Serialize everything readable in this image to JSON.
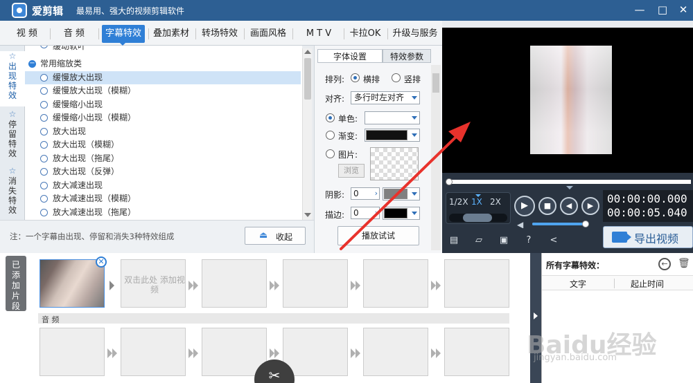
{
  "window": {
    "app_name": "爱剪辑",
    "tagline": "最易用、强大的视频剪辑软件",
    "minimize": "—",
    "maximize": "□",
    "close": "✕"
  },
  "menu_tabs": [
    "视 频",
    "音 频",
    "字幕特效",
    "叠加素材",
    "转场特效",
    "画面风格",
    "M T V",
    "卡拉OK",
    "升级与服务"
  ],
  "active_menu_tab": "字幕特效",
  "side_tabs": [
    {
      "label": "出现特效",
      "icon": "star-icon",
      "active": true
    },
    {
      "label": "停留特效",
      "icon": "star-icon",
      "active": false
    },
    {
      "label": "消失特效",
      "icon": "star-icon",
      "active": false
    }
  ],
  "effects_list": {
    "partial_top": "缓动软叶",
    "category": "常用缩放类",
    "items": [
      "缓慢放大出现",
      "缓慢放大出现（模糊）",
      "缓慢缩小出现",
      "缓慢缩小出现（模糊）",
      "放大出现",
      "放大出现（模糊）",
      "放大出现（拖尾）",
      "放大出现（反弹）",
      "放大减速出现",
      "放大减速出现（模糊）",
      "放大减速出现（拖尾）"
    ],
    "selected": "缓慢放大出现"
  },
  "note": {
    "text": "注：一个字幕由出现、停留和消失3种特效组成",
    "collapse_label": "收起"
  },
  "settings": {
    "tabs": [
      "字体设置",
      "特效参数"
    ],
    "active_tab": "字体设置",
    "layout_label": "排列:",
    "layout_options": [
      "横排",
      "竖排"
    ],
    "layout_selected": "横排",
    "align_label": "对齐:",
    "align_value": "多行时左对齐",
    "solid_label": "单色:",
    "gradient_label": "渐变:",
    "image_label": "图片:",
    "browse_label": "浏览",
    "shadow_label": "阴影:",
    "shadow_value": "0",
    "stroke_label": "描边:",
    "stroke_value": "0",
    "play_test_label": "播放试试",
    "colors": {
      "solid": "#ffffff",
      "gradient": "#111111",
      "shadow": "#808080",
      "stroke": "#000000"
    }
  },
  "player": {
    "speeds": [
      "1/2X",
      "1X",
      "2X"
    ],
    "active_speed": "1X",
    "current_time": "00:00:00.000",
    "total_time": "00:00:05.040",
    "progress": 0,
    "volume": 1.0
  },
  "toolbar_icons": [
    "new-project-icon",
    "open-folder-icon",
    "save-icon",
    "help-icon",
    "share-icon"
  ],
  "export_label": "导出视频",
  "timeline": {
    "added_tab_label": "已添加片段",
    "double_click_hint": "双击此处 添加视频",
    "audio_label": "音 频"
  },
  "subtitle_panel": {
    "title": "所有字幕特效：",
    "columns": [
      "文字",
      "起止时间"
    ]
  },
  "watermark": {
    "main": "Baidu经验",
    "sub": "jingyan.baidu.com"
  },
  "colors": {
    "accent": "#2f7fd6",
    "titlebar": "#2d5f93",
    "annotation_arrow": "#e8322c"
  }
}
